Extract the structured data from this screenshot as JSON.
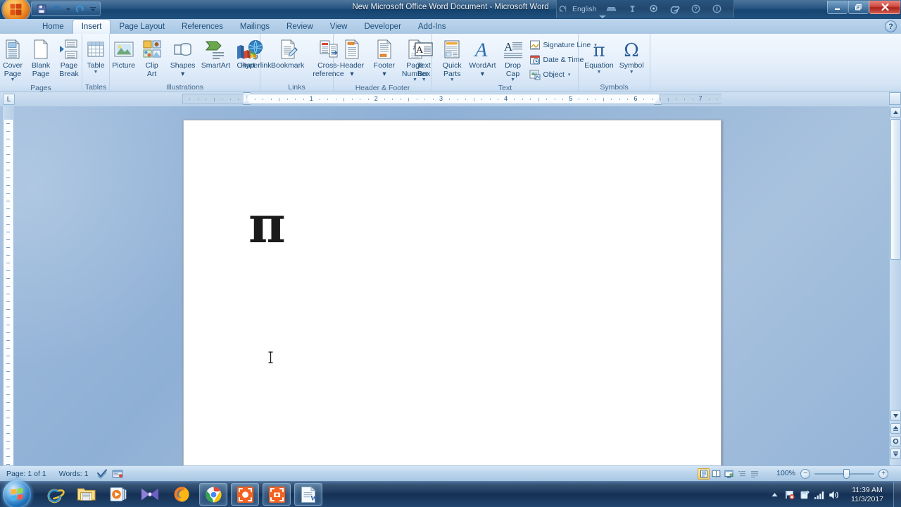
{
  "window": {
    "title": "New Microsoft Office Word Document - Microsoft Word",
    "minimize_label": "—",
    "restore_label": "❐",
    "close_label": "✕",
    "help_label": "?"
  },
  "quick_access": {
    "items": [
      {
        "name": "save-icon",
        "tooltip": "Save"
      },
      {
        "name": "undo-icon",
        "tooltip": "Undo"
      },
      {
        "name": "undo-dropdown-icon",
        "tooltip": "Undo options"
      },
      {
        "name": "redo-icon",
        "tooltip": "Redo"
      },
      {
        "name": "customize-qat-icon",
        "tooltip": "Customize Quick Access Toolbar"
      }
    ]
  },
  "language_bar": {
    "language": "English",
    "icons": [
      "restore-language-bar-icon",
      "keyboard-icon",
      "correction-icon",
      "ime-icon",
      "ie-icon",
      "help-icon",
      "options-icon"
    ]
  },
  "tabs": [
    {
      "label": "Home",
      "active": false
    },
    {
      "label": "Insert",
      "active": true
    },
    {
      "label": "Page Layout",
      "active": false
    },
    {
      "label": "References",
      "active": false
    },
    {
      "label": "Mailings",
      "active": false
    },
    {
      "label": "Review",
      "active": false
    },
    {
      "label": "View",
      "active": false
    },
    {
      "label": "Developer",
      "active": false
    },
    {
      "label": "Add-Ins",
      "active": false
    }
  ],
  "ribbon": {
    "groups": [
      {
        "label": "Pages",
        "buttons": [
          {
            "label": "Cover\nPage",
            "icon": "cover-page-icon",
            "dropdown": true
          },
          {
            "label": "Blank\nPage",
            "icon": "blank-page-icon",
            "dropdown": false
          },
          {
            "label": "Page\nBreak",
            "icon": "page-break-icon",
            "dropdown": false
          }
        ]
      },
      {
        "label": "Tables",
        "buttons": [
          {
            "label": "Table",
            "icon": "table-icon",
            "dropdown": true
          }
        ]
      },
      {
        "label": "Illustrations",
        "buttons": [
          {
            "label": "Picture",
            "icon": "picture-icon",
            "dropdown": false
          },
          {
            "label": "Clip\nArt",
            "icon": "clip-art-icon",
            "dropdown": false
          },
          {
            "label": "Shapes",
            "icon": "shapes-icon",
            "dropdown": true
          },
          {
            "label": "SmartArt",
            "icon": "smartart-icon",
            "dropdown": false
          },
          {
            "label": "Chart",
            "icon": "chart-icon",
            "dropdown": false
          }
        ]
      },
      {
        "label": "Links",
        "buttons": [
          {
            "label": "Hyperlink",
            "icon": "hyperlink-icon",
            "dropdown": false
          },
          {
            "label": "Bookmark",
            "icon": "bookmark-icon",
            "dropdown": false
          },
          {
            "label": "Cross-reference",
            "icon": "cross-reference-icon",
            "dropdown": false
          }
        ]
      },
      {
        "label": "Header & Footer",
        "buttons": [
          {
            "label": "Header",
            "icon": "header-icon",
            "dropdown": true
          },
          {
            "label": "Footer",
            "icon": "footer-icon",
            "dropdown": true
          },
          {
            "label": "Page\nNumber",
            "icon": "page-number-icon",
            "dropdown": true
          }
        ]
      },
      {
        "label": "Text",
        "buttons": [
          {
            "label": "Text\nBox",
            "icon": "text-box-icon",
            "dropdown": true
          },
          {
            "label": "Quick\nParts",
            "icon": "quick-parts-icon",
            "dropdown": true
          },
          {
            "label": "WordArt",
            "icon": "wordart-icon",
            "dropdown": true
          },
          {
            "label": "Drop\nCap",
            "icon": "drop-cap-icon",
            "dropdown": true
          }
        ],
        "small_buttons": [
          {
            "label": "Signature Line",
            "icon": "signature-line-icon",
            "dropdown": true
          },
          {
            "label": "Date & Time",
            "icon": "date-time-icon",
            "dropdown": false
          },
          {
            "label": "Object",
            "icon": "object-icon",
            "dropdown": true
          }
        ]
      },
      {
        "label": "Symbols",
        "buttons": [
          {
            "label": "Equation",
            "icon": "equation-icon",
            "glyph": "π",
            "dropdown": true
          },
          {
            "label": "Symbol",
            "icon": "symbol-icon",
            "glyph": "Ω",
            "dropdown": true
          }
        ]
      }
    ]
  },
  "ruler": {
    "horizontal_numbers": [
      "1",
      "1",
      "2",
      "3",
      "4",
      "5",
      "6",
      "7"
    ],
    "tab_selector": "L",
    "left_indent_marker": "first-line-indent-marker",
    "right_indent_marker": "right-indent-marker"
  },
  "document": {
    "content": "π",
    "cursor": "i-beam-cursor"
  },
  "status_bar": {
    "page": "Page: 1 of 1",
    "words": "Words: 1",
    "proofing_icon": "proofing-errors-icon",
    "language_icon": "language-icon",
    "zoom_level": "100%",
    "zoom_out": "−",
    "zoom_in": "+",
    "view_buttons": [
      {
        "name": "print-layout-view",
        "selected": true
      },
      {
        "name": "full-screen-reading-view",
        "selected": false
      },
      {
        "name": "web-layout-view",
        "selected": false
      },
      {
        "name": "outline-view",
        "selected": false
      },
      {
        "name": "draft-view",
        "selected": false
      }
    ]
  },
  "taskbar": {
    "start_label": "Start",
    "items": [
      {
        "name": "taskbar-internet-explorer",
        "running": false
      },
      {
        "name": "taskbar-windows-explorer",
        "running": false
      },
      {
        "name": "taskbar-windows-media-player",
        "running": false
      },
      {
        "name": "taskbar-movie-maker",
        "running": false
      },
      {
        "name": "taskbar-firefox",
        "running": false
      },
      {
        "name": "taskbar-google-chrome",
        "running": true
      },
      {
        "name": "taskbar-capture-app",
        "running": true
      },
      {
        "name": "taskbar-screenshot-app",
        "running": true
      },
      {
        "name": "taskbar-microsoft-word",
        "running": true
      }
    ],
    "tray": [
      {
        "name": "show-hidden-icons-arrow"
      },
      {
        "name": "action-center-flag-icon"
      },
      {
        "name": "removable-media-icon"
      },
      {
        "name": "network-signal-icon"
      },
      {
        "name": "volume-icon"
      }
    ],
    "time": "11:39 AM",
    "date": "11/3/2017"
  },
  "colors": {
    "accent": "#1e4f7e",
    "ribbon_bg": "#e4eefa",
    "tab_active": "#fdfeff",
    "desktop": "#9fbcdd"
  }
}
